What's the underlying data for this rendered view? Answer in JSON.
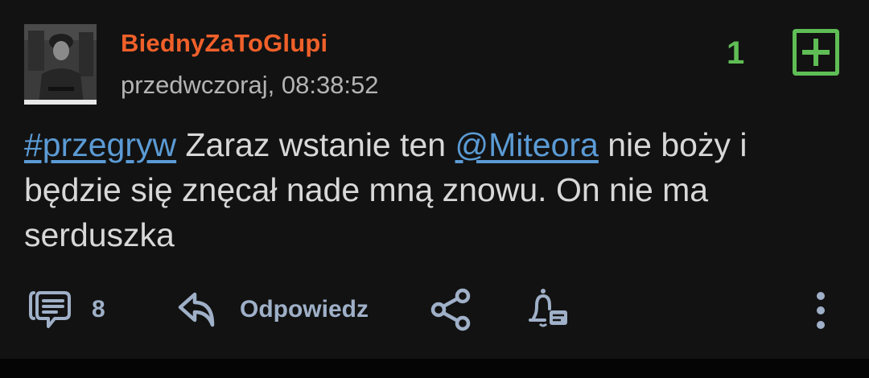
{
  "post": {
    "author": "BiednyZaToGlupi",
    "timestamp": "przedwczoraj, 08:38:52",
    "score": "1",
    "content": {
      "tag": "#przegryw",
      "text1": " Zaraz wstanie ten ",
      "mention": "@Miteora",
      "text2": " nie boży i będzie się znęcał nade mną znowu. On nie ma serduszka"
    },
    "comments_count": "8",
    "reply_label": "Odpowiedz"
  },
  "colors": {
    "background": "#121212",
    "username": "#f0602a",
    "score": "#5fbd55",
    "link": "#5b9bd5",
    "action": "#9fb0c8"
  },
  "icons": [
    "comment-icon",
    "reply-icon",
    "share-icon",
    "notification-bell-icon",
    "more-options-icon",
    "plus-icon"
  ]
}
